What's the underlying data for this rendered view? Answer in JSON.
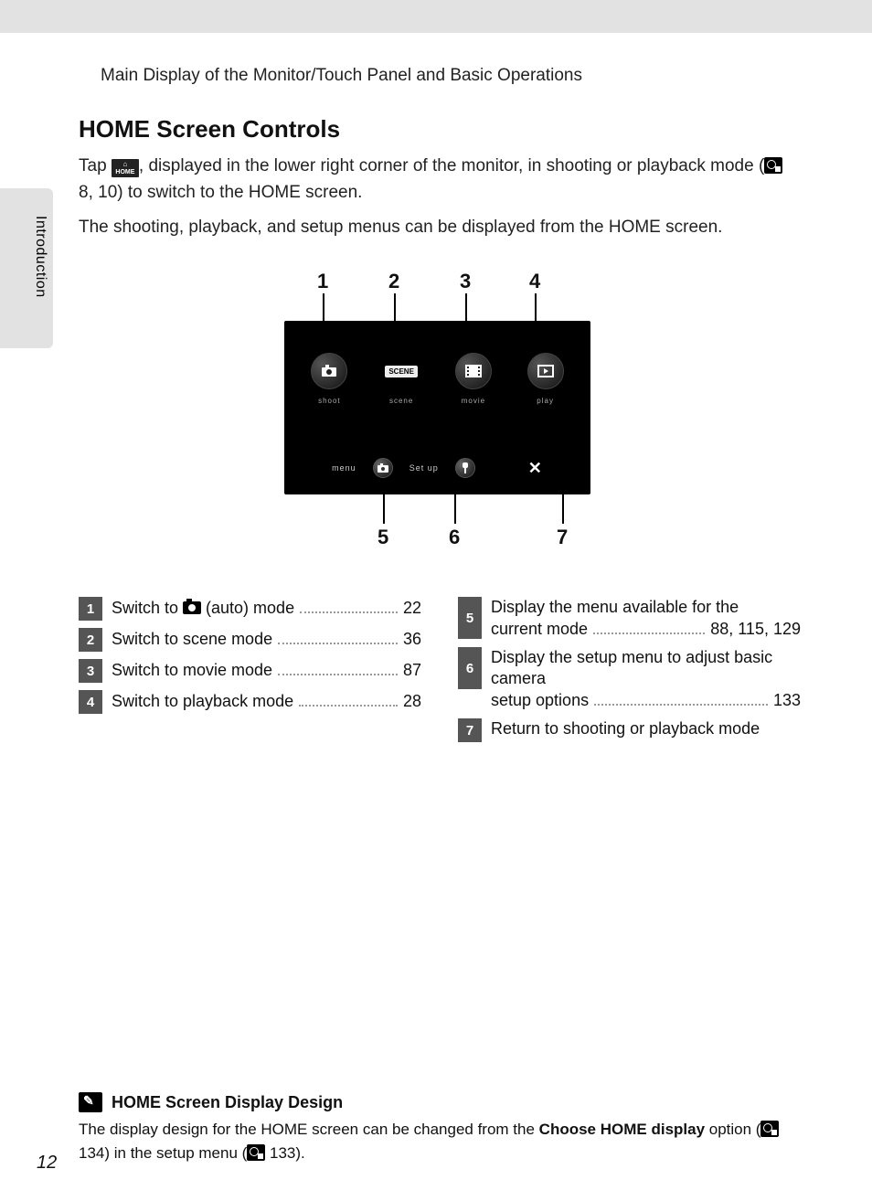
{
  "chapter_header": "Main Display of the Monitor/Touch Panel and Basic Operations",
  "sidebar": "Introduction",
  "title": "HOME Screen Controls",
  "para1a": "Tap ",
  "para1b": ", displayed in the lower right corner of the monitor, in shooting or playback mode (",
  "para1c": " 8, 10) to switch to the HOME screen.",
  "para2": "The shooting, playback, and setup menus can be displayed from the HOME screen.",
  "home_badge": "HOME",
  "callouts": {
    "c1": "1",
    "c2": "2",
    "c3": "3",
    "c4": "4",
    "c5": "5",
    "c6": "6",
    "c7": "7"
  },
  "screen": {
    "shoot": "shoot",
    "scene": "scene",
    "scene_box": "SCENE",
    "movie": "movie",
    "play": "play",
    "menu": "menu",
    "setup": "Set up"
  },
  "legend_left": [
    {
      "n": "1",
      "t_a": "Switch to ",
      "t_b": " (auto) mode",
      "p": "22",
      "has_icon": true
    },
    {
      "n": "2",
      "t_a": "Switch to scene mode",
      "t_b": "",
      "p": "36",
      "has_icon": false
    },
    {
      "n": "3",
      "t_a": "Switch to movie mode",
      "t_b": "",
      "p": "87",
      "has_icon": false
    },
    {
      "n": "4",
      "t_a": "Switch to playback mode",
      "t_b": "",
      "p": "28",
      "has_icon": false
    }
  ],
  "legend_right": [
    {
      "n": "5",
      "t": "Display the menu available for the current mode",
      "p": "88, 115, 129"
    },
    {
      "n": "6",
      "t": "Display the setup menu to adjust basic camera setup options",
      "p": "133"
    },
    {
      "n": "7",
      "t": "Return to shooting or playback mode",
      "p": ""
    }
  ],
  "note": {
    "title": "HOME Screen Display Design",
    "body_a": "The display design for the HOME screen can be changed from the ",
    "body_bold": "Choose HOME display",
    "body_b": " option (",
    "ref1": " 134) in the setup menu (",
    "ref2": " 133)."
  },
  "page_number": "12"
}
